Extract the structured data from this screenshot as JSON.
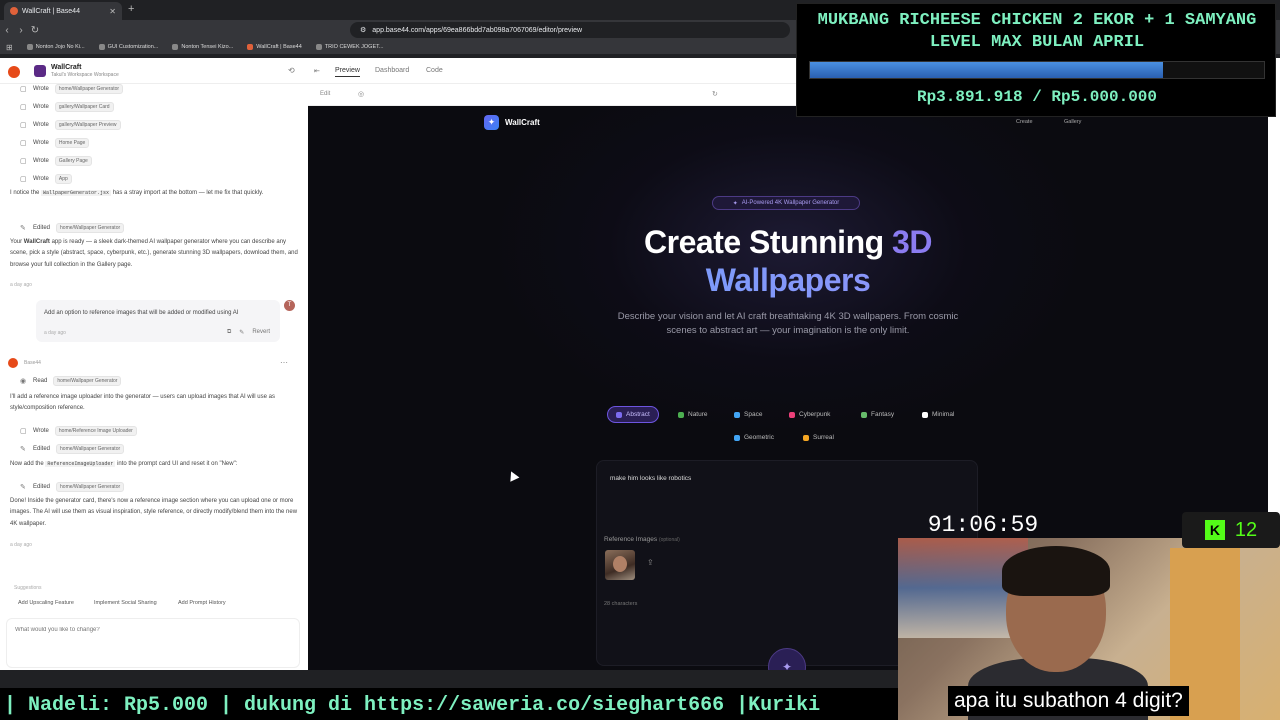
{
  "browser": {
    "tab_title": "WallCraft | Base44",
    "url": "app.base44.com/apps/69ea866bdd7ab098a7067069/editor/preview",
    "bookmarks": [
      "Nonton Jojo No Ki...",
      "GUI Customization...",
      "Nonton Tensei Kizo...",
      "WallCraft | Base44",
      "TRIO CEWEK JOGET..."
    ]
  },
  "chat": {
    "app_name": "WallCraft",
    "workspace": "Takul's Workspace Workspace",
    "actions_top": [
      {
        "verb": "Wrote",
        "target": "home/Wallpaper Generator"
      },
      {
        "verb": "Wrote",
        "target": "gallery/Wallpaper Card"
      },
      {
        "verb": "Wrote",
        "target": "gallery/Wallpaper Preview"
      },
      {
        "verb": "Wrote",
        "target": "Home Page"
      },
      {
        "verb": "Wrote",
        "target": "Gallery Page"
      },
      {
        "verb": "Wrote",
        "target": "App"
      }
    ],
    "notice_pre": "I notice the",
    "notice_code": "WallpaperGenerator.jsx",
    "notice_post": "has a stray import at the bottom — let me fix that quickly.",
    "edited1": {
      "verb": "Edited",
      "target": "home/Wallpaper Generator"
    },
    "ready_pre": "Your",
    "ready_bold": "WallCraft",
    "ready_post": "app is ready — a sleek dark-themed AI wallpaper generator where you can describe any scene, pick a style (abstract, space, cyberpunk, etc.), generate stunning 3D wallpapers, download them, and browse your full collection in the Gallery page.",
    "ts1": "a day ago",
    "user_msg": "Add an option to reference images that will be added or modified using AI",
    "user_ts": "a day ago",
    "user_initial": "T",
    "revert": "Revert",
    "base_label": "Base44",
    "read": {
      "verb": "Read",
      "target": "home/Wallpaper Generator"
    },
    "plan": "I'll add a reference image uploader into the generator — users can upload images that AI will use as style/composition reference.",
    "wrote_ref": {
      "verb": "Wrote",
      "target": "home/Reference Image Uploader"
    },
    "edited2": {
      "verb": "Edited",
      "target": "home/Wallpaper Generator"
    },
    "now_pre": "Now add the",
    "now_code": "ReferenceImageUploader",
    "now_post": "into the prompt card UI and reset it on \"New\":",
    "edited3": {
      "verb": "Edited",
      "target": "home/Wallpaper Generator"
    },
    "done": "Done! Inside the generator card, there's now a reference image section where you can upload one or more images. The AI will use them as visual inspiration, style reference, or directly modify/blend them into the new 4K wallpaper.",
    "ts2": "a day ago",
    "suggestions_label": "Suggestions",
    "suggestions": [
      "Add Upscaling Feature",
      "Implement Social Sharing",
      "Add Prompt History"
    ],
    "input_placeholder": "What would you like to change?"
  },
  "pane": {
    "tabs": [
      "Preview",
      "Dashboard",
      "Code"
    ],
    "active_tab": "Preview",
    "edit_label": "Edit"
  },
  "site": {
    "brand": "WallCraft",
    "nav": [
      "Create",
      "Gallery"
    ],
    "pill": "AI-Powered 4K Wallpaper Generator",
    "headline_1": "Create Stunning",
    "headline_1_accent": "3D",
    "headline_2": "Wallpapers",
    "description": "Describe your vision and let AI craft breathtaking 4K 3D wallpapers. From cosmic scenes to abstract art — your imagination is the only limit.",
    "styles": [
      "Abstract",
      "Nature",
      "Space",
      "Cyberpunk",
      "Fantasy",
      "Minimal",
      "Geometric",
      "Surreal"
    ],
    "active_style": "Abstract",
    "style_colors": [
      "#7c6cf0",
      "#4caf50",
      "#42a5f5",
      "#ec407a",
      "#66bb6a",
      "#ffffff",
      "#42a5f5",
      "#f5a623"
    ],
    "prompt": "make him looks like robotics",
    "ref_label": "Reference Images",
    "ref_optional": "(optional)",
    "char_count": "28 characters"
  },
  "overlay": {
    "donation_title": "MUKBANG RICHEESE CHICKEN 2 EKOR + 1 SAMYANG LEVEL MAX BULAN APRIL",
    "donation_amount": "Rp3.891.918 / Rp5.000.000",
    "donation_progress": 0.778,
    "timer": "91:06:59",
    "kick_count": "12",
    "ticker": "| Nadeli: Rp5.000 |  dukung di https://saweria.co/sieghart666 |Kuriki",
    "caption": "apa itu subathon 4 digit?",
    "accent_color": "#7ef0c0",
    "kick_color": "#53fc18"
  }
}
